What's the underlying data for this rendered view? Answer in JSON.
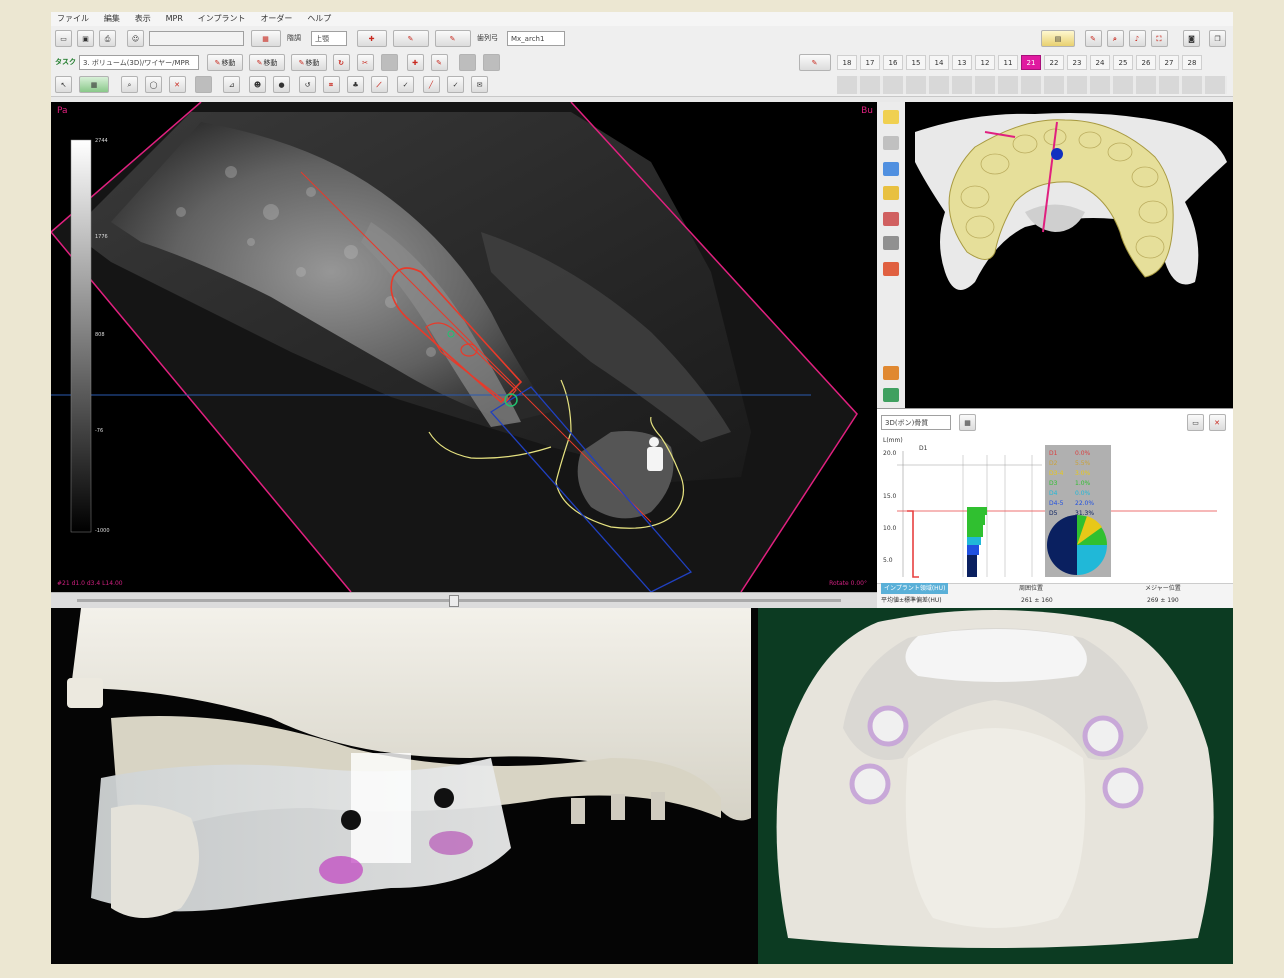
{
  "menu": [
    "ファイル",
    "編集",
    "表示",
    "MPR",
    "インプラント",
    "オーダー",
    "ヘルプ"
  ],
  "toolbar1": {
    "preset_value": "",
    "preset_label": "階調",
    "position_label": "上顎",
    "arch_label": "歯列弓",
    "arch_value": "Mx_arch1"
  },
  "toolbar2": {
    "task_label": "タスク",
    "task_value": "3. ボリューム(3D)/ワイヤー/MPR",
    "btn_a": "移動",
    "btn_b": "移動",
    "btn_c": "移動",
    "btn_d": "",
    "btn_e": ""
  },
  "teeth": [
    "18",
    "17",
    "16",
    "15",
    "14",
    "13",
    "12",
    "11",
    "21",
    "22",
    "23",
    "24",
    "25",
    "26",
    "27",
    "28"
  ],
  "active_tooth": "21",
  "mpr": {
    "corner_left": "Pa",
    "corner_right": "Bu",
    "status_left": "#21  d1.0  d3.4  L14.00",
    "status_right": "Rotate  0.00°",
    "scale_labels": [
      "2744",
      "1776",
      "808",
      "-76",
      "-1000"
    ]
  },
  "density_panel": {
    "dropdown": "3D(ボン)骨質",
    "yaxis_label": "L(mm)",
    "y_ticks": [
      "20.0",
      "15.0",
      "10.0",
      "5.0"
    ],
    "marker": "D1",
    "legend": [
      {
        "key": "D1",
        "value": "0.0%",
        "color": "#d94040"
      },
      {
        "key": "D2",
        "value": "5.5%",
        "color": "#c9a23a"
      },
      {
        "key": "D3-4",
        "value": "3.0%",
        "color": "#e8c818"
      },
      {
        "key": "D3",
        "value": "1.0%",
        "color": "#30c030"
      },
      {
        "key": "D4",
        "value": "0.0%",
        "color": "#20b8d8"
      },
      {
        "key": "D4-5",
        "value": "22.0%",
        "color": "#2050e0"
      },
      {
        "key": "D5",
        "value": "31.3%",
        "color": "#0a2060"
      }
    ],
    "footer_title": "インプラント領域(HU)",
    "footer_row_label": "平均値±標準偏差(HU)",
    "col_mid": "周囲位置",
    "col_right": "メジャー位置",
    "val_mid": "261 ± 160",
    "val_right": "269 ± 190"
  },
  "colors": {
    "accent": "#e01aa0",
    "implant": "#e83a2a",
    "guide": "#2040c0",
    "gum": "#e8e48a"
  },
  "icons": {
    "active_tooth": "tooth-21-icon"
  }
}
